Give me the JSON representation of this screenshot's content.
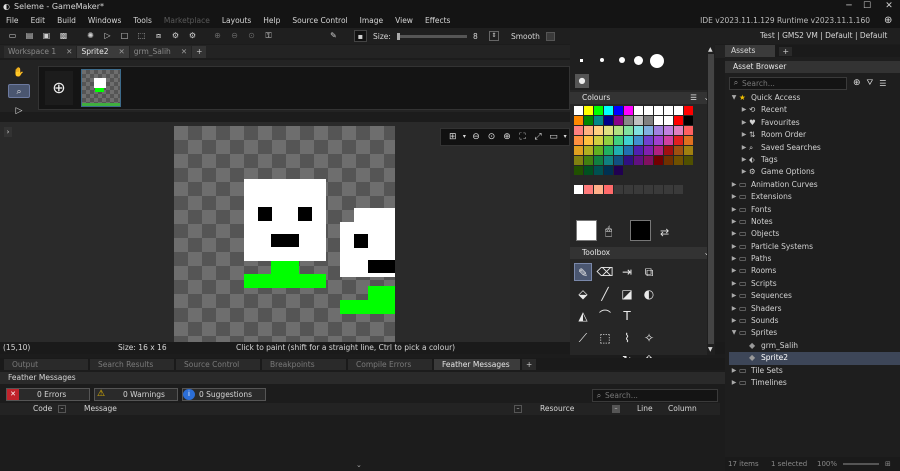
{
  "window": {
    "title": "Seleme - GameMaker*"
  },
  "menu": {
    "items": [
      "File",
      "Edit",
      "Build",
      "Windows",
      "Tools",
      "Marketplace",
      "Layouts",
      "Help",
      "Source Control",
      "Image",
      "View",
      "Effects"
    ],
    "version_text": "IDE v2023.11.1.129  Runtime v2023.11.1.160"
  },
  "target": {
    "text": "Test | GMS2 VM | Default | Default"
  },
  "toolbar": {
    "size_label": "Size:",
    "size_value": "8",
    "smooth_label": "Smooth"
  },
  "tabs": [
    {
      "label": "Workspace 1",
      "active": false
    },
    {
      "label": "Sprite2",
      "active": true
    },
    {
      "label": "grm_Salih",
      "active": false
    }
  ],
  "colours": {
    "header": "Colours",
    "palette": [
      "#ffffff",
      "#ffff00",
      "#00ff00",
      "#00ffff",
      "#0000ff",
      "#ff00ff",
      "#ffffff",
      "#ffffff",
      "#ffffff",
      "#ffffff",
      "#ffffff",
      "#ff0000",
      "#ff8800",
      "#008800",
      "#008888",
      "#000088",
      "#880088",
      "#888888",
      "#c0c0c0",
      "#808080",
      "#ffffff",
      "#ffffff",
      "#ff0000",
      "#000000",
      "#ff8080",
      "#ffb080",
      "#ffd080",
      "#e0e080",
      "#b0e080",
      "#80e0a0",
      "#80e0e0",
      "#80b0e0",
      "#a080e0",
      "#c080e0",
      "#e080c0",
      "#ff6060",
      "#ff9040",
      "#ffc040",
      "#d0d040",
      "#90d040",
      "#40d080",
      "#40d0d0",
      "#4090d0",
      "#7040d0",
      "#a040d0",
      "#d040a0",
      "#e02020",
      "#e07020",
      "#e0a020",
      "#b0b020",
      "#60b020",
      "#20b060",
      "#20b0b0",
      "#2070b0",
      "#5020b0",
      "#8020b0",
      "#b02080",
      "#a01010",
      "#a05010",
      "#a08010",
      "#808010",
      "#408010",
      "#108040",
      "#108080",
      "#105080",
      "#301080",
      "#601080",
      "#801060",
      "#700000",
      "#703000",
      "#705000",
      "#505000",
      "#205000",
      "#005020",
      "#005050",
      "#003050",
      "#200050"
    ],
    "custom": [
      "#ffffff",
      "#ff7b7b",
      "#ffb08a",
      "#ff6a6a",
      "#3a3a3a",
      "#3a3a3a",
      "#3a3a3a",
      "#3a3a3a",
      "#3a3a3a",
      "#3a3a3a",
      "#3a3a3a"
    ],
    "primary": "#ffffff",
    "secondary": "#000000"
  },
  "toolbox": {
    "header": "Toolbox"
  },
  "status": {
    "coords": "(15,10)",
    "size": "Size: 16 x 16",
    "hint": "Click to paint (shift for a straight line, Ctrl to pick a colour)"
  },
  "bottom": {
    "tabs": [
      "Output",
      "Search Results",
      "Source Control",
      "Breakpoints",
      "Compile Errors",
      "Feather Messages"
    ],
    "panel_title": "Feather Messages",
    "errors": "0 Errors",
    "warnings": "0 Warnings",
    "suggestions": "0 Suggestions",
    "search_placeholder": "Search...",
    "columns": [
      "Code",
      "Message",
      "Resource",
      "Line",
      "Column"
    ]
  },
  "assets": {
    "tab": "Assets",
    "header": "Asset Browser",
    "search_placeholder": "Search...",
    "quick_access": "Quick Access",
    "quick_items": [
      "Recent",
      "Favourites",
      "Room Order",
      "Saved Searches",
      "Tags",
      "Game Options"
    ],
    "folders": [
      "Animation Curves",
      "Extensions",
      "Fonts",
      "Notes",
      "Objects",
      "Particle Systems",
      "Paths",
      "Rooms",
      "Scripts",
      "Sequences",
      "Shaders",
      "Sounds",
      "Sprites"
    ],
    "sprite_items": [
      "grm_Salih",
      "Sprite2"
    ],
    "folders_after": [
      "Tile Sets",
      "Timelines"
    ],
    "footer_items": "17 items",
    "footer_selected": "1 selected",
    "footer_zoom": "100%"
  },
  "accent": "#f0c000",
  "sprite_colors": {
    "face": "#ffffff",
    "eyes": "#000000",
    "body": "#00ff00"
  }
}
